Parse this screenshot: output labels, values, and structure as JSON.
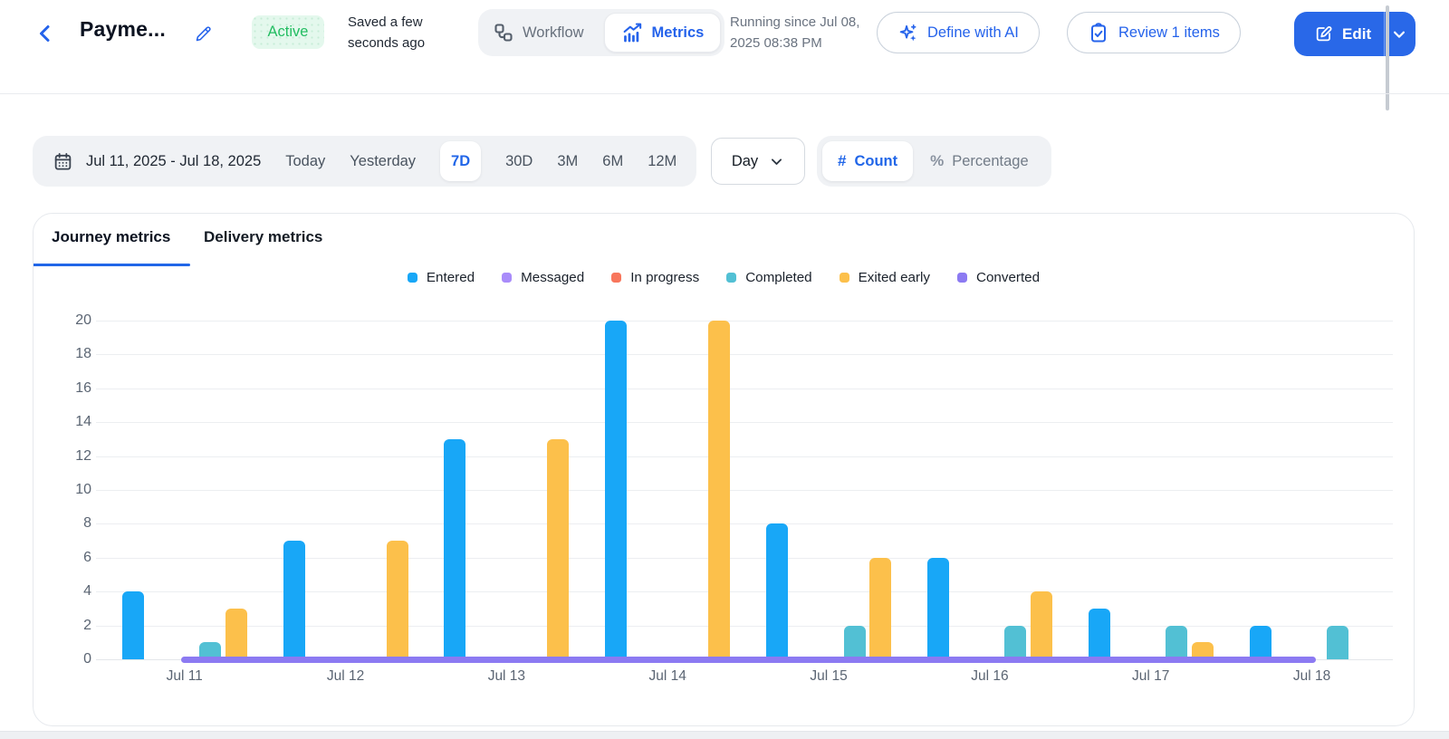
{
  "header": {
    "title": "Payme...",
    "status_badge": "Active",
    "saved_text": "Saved a few seconds ago",
    "workflow_label": "Workflow",
    "metrics_label": "Metrics",
    "running_since": "Running since Jul 08, 2025 08:38 PM",
    "define_ai_label": "Define with AI",
    "review_label": "Review 1 items",
    "edit_label": "Edit"
  },
  "filters": {
    "date_range": "Jul 11, 2025 - Jul 18, 2025",
    "presets": [
      "Today",
      "Yesterday",
      "7D",
      "30D",
      "3M",
      "6M",
      "12M"
    ],
    "selected_preset": "7D",
    "granularity": "Day",
    "mode_count_label": "Count",
    "mode_percentage_label": "Percentage",
    "selected_mode": "Count",
    "hash_glyph": "#",
    "percent_glyph": "%"
  },
  "card": {
    "tab_journey": "Journey metrics",
    "tab_delivery": "Delivery metrics",
    "active_tab": "Journey metrics"
  },
  "chart_data": {
    "type": "bar",
    "title": "Journey metrics",
    "categories": [
      "Jul 11",
      "Jul 12",
      "Jul 13",
      "Jul 14",
      "Jul 15",
      "Jul 16",
      "Jul 17",
      "Jul 18"
    ],
    "series": [
      {
        "name": "Entered",
        "type": "bar",
        "color": "#18A7F7",
        "values": [
          4,
          7,
          13,
          20,
          8,
          6,
          3,
          2
        ]
      },
      {
        "name": "Messaged",
        "type": "bar",
        "color": "#A98CFA",
        "values": [
          0,
          0,
          0,
          0,
          0,
          0,
          0,
          0
        ]
      },
      {
        "name": "In progress",
        "type": "bar",
        "color": "#F8765C",
        "values": [
          0,
          0,
          0,
          0,
          0,
          0,
          0,
          0
        ]
      },
      {
        "name": "Completed",
        "type": "bar",
        "color": "#52C0D4",
        "values": [
          1,
          0,
          0,
          0,
          2,
          2,
          2,
          2
        ]
      },
      {
        "name": "Exited early",
        "type": "bar",
        "color": "#FCC04B",
        "values": [
          3,
          7,
          13,
          20,
          6,
          4,
          1,
          0
        ]
      },
      {
        "name": "Converted",
        "type": "line",
        "color": "#8C7AF2",
        "values": [
          0,
          0,
          0,
          0,
          0,
          0,
          0,
          0
        ]
      }
    ],
    "ylim": [
      0,
      20
    ],
    "ytick_step": 2,
    "xlabel": "",
    "ylabel": "",
    "grid": true,
    "legend_position": "top"
  },
  "colors": {
    "accent_blue": "#2563EB",
    "edit_button_blue": "#2968E8",
    "active_green": "#23BD62",
    "active_green_bg": "#E4F8ED",
    "muted_gray": "#6A7380",
    "axis_gray": "#5B6573",
    "pill_bg": "#F0F2F5",
    "converted_line": "#8C7AF2"
  }
}
